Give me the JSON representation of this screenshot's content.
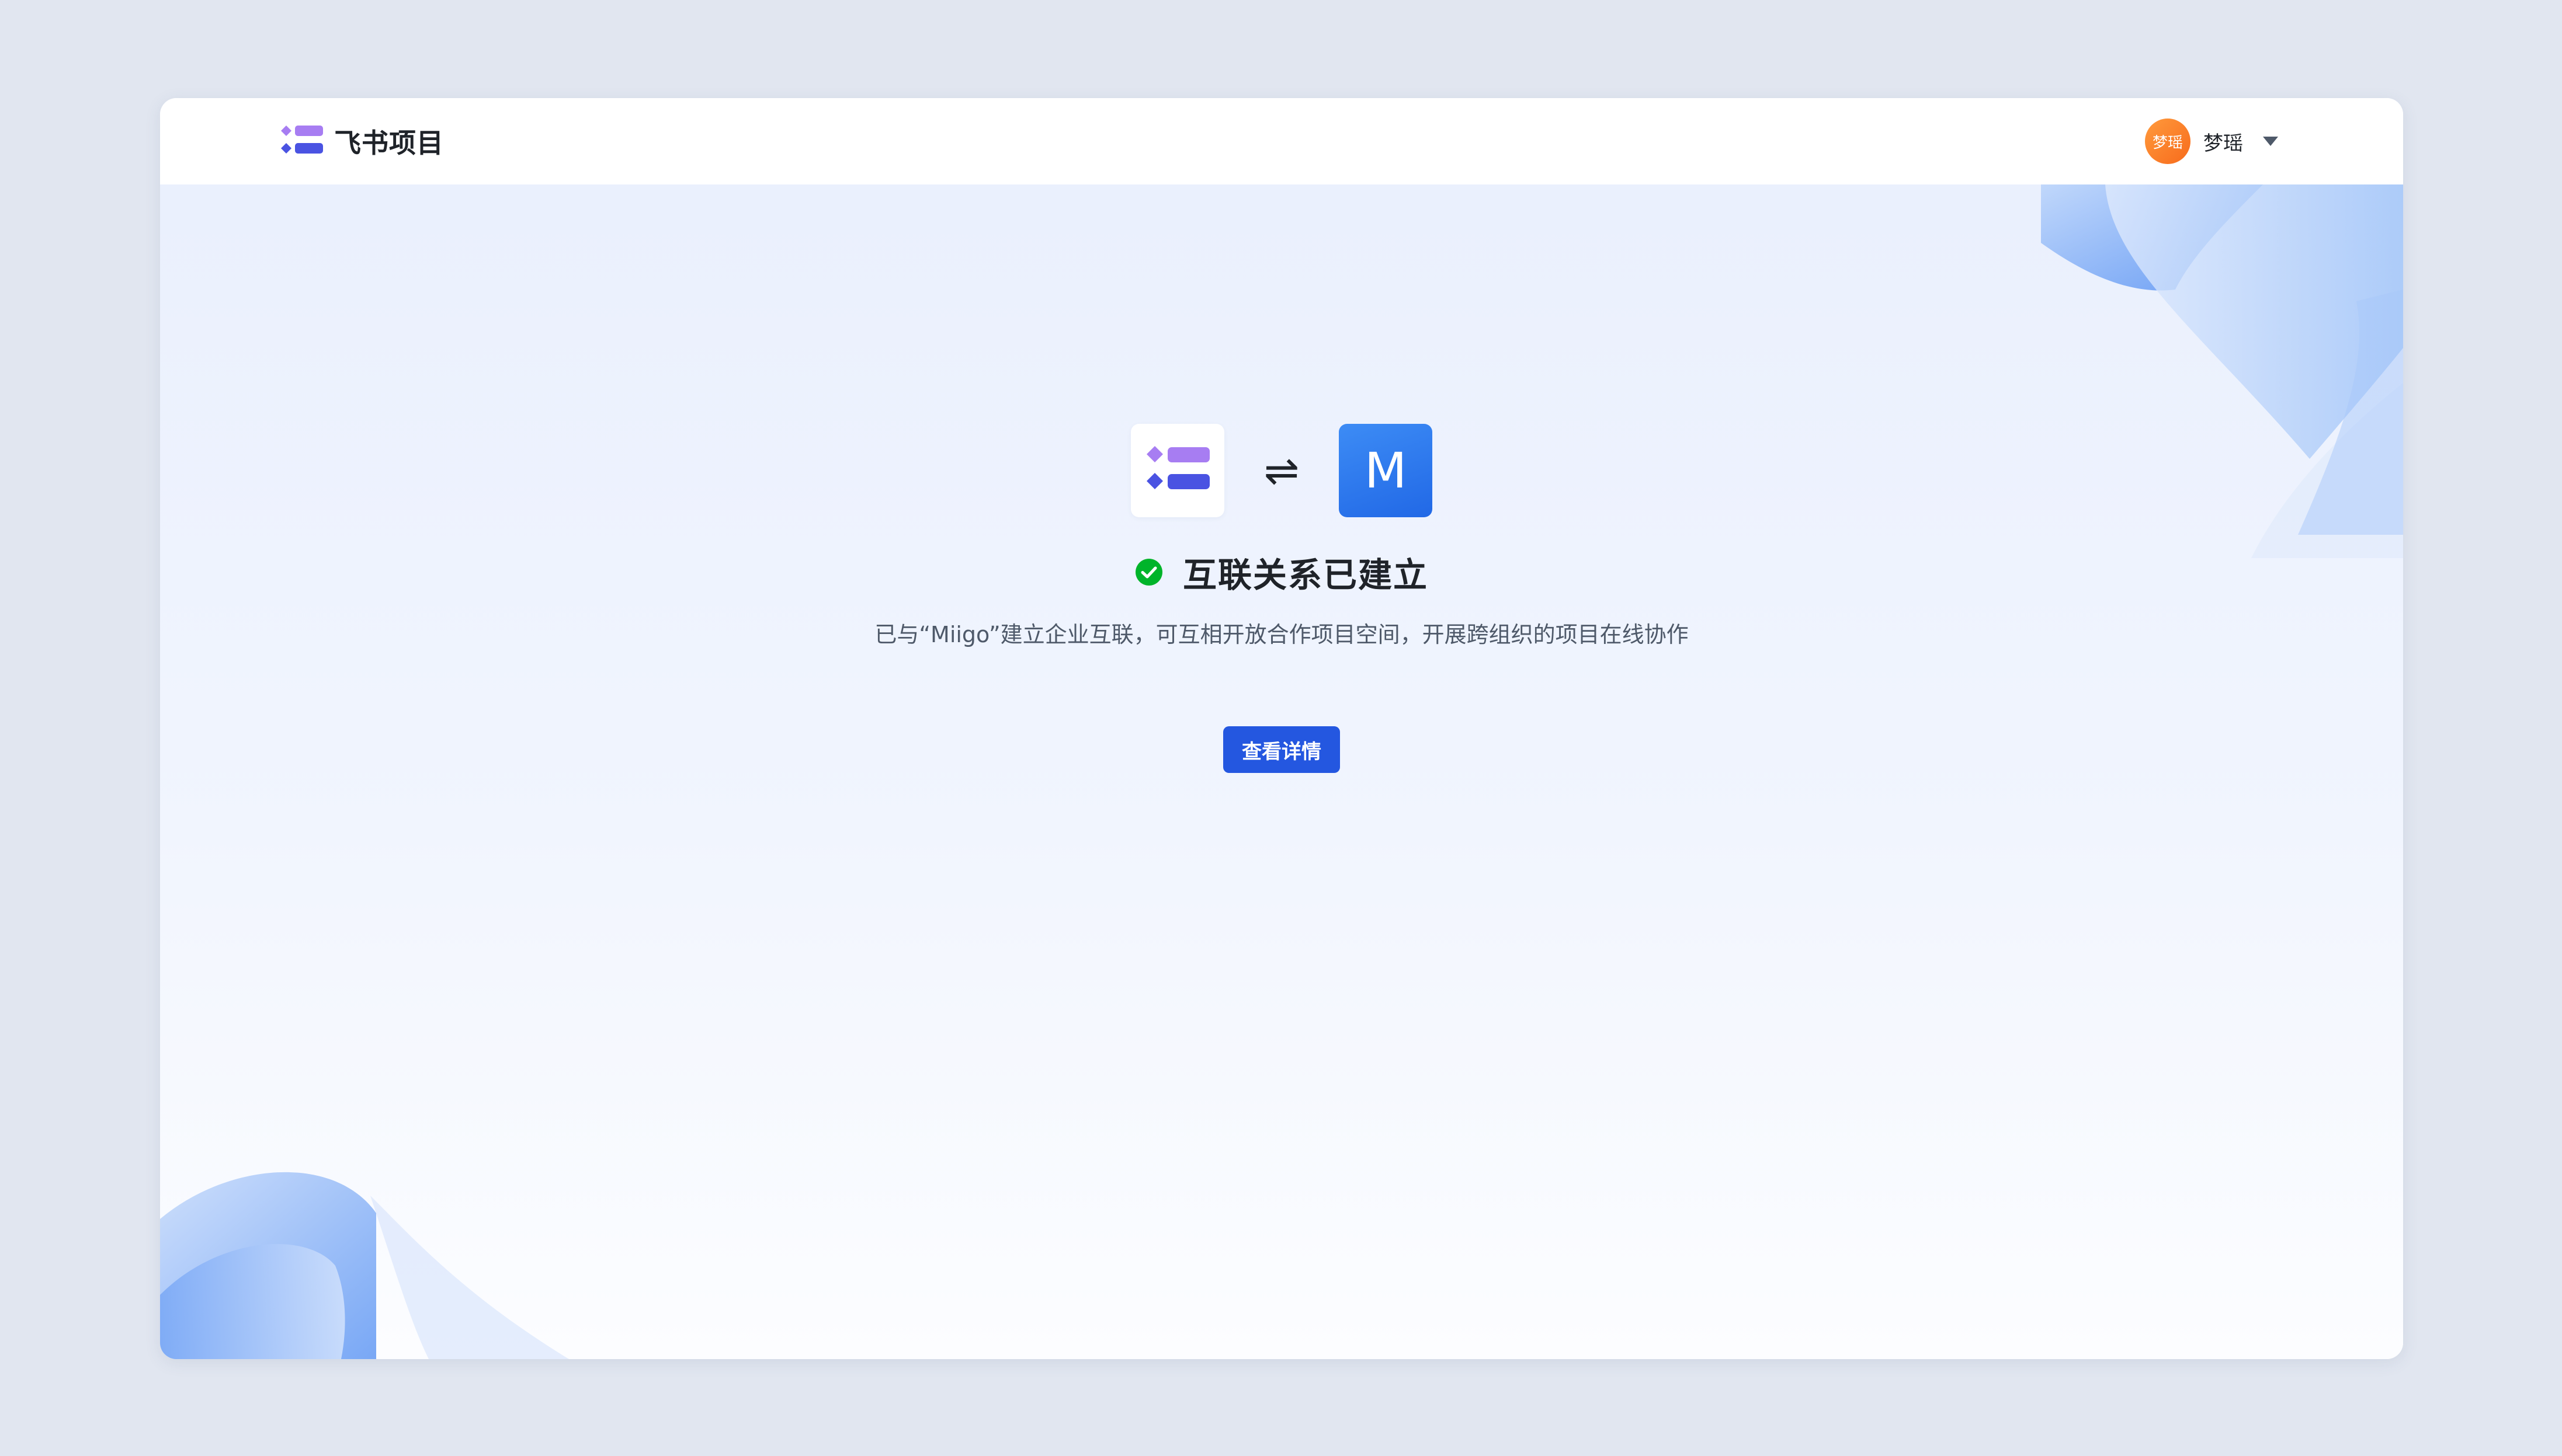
{
  "header": {
    "app_name": "飞书项目",
    "user": {
      "avatar_text": "梦瑶",
      "name": "梦瑶"
    }
  },
  "connection": {
    "swap_symbol": "⇌",
    "partner_logo_letter": "M",
    "title": "互联关系已建立",
    "description": "已与“Miigo”建立企业互联，可互相开放合作项目空间，开展跨组织的项目在线协作",
    "button_label": "查看详情"
  },
  "colors": {
    "primary": "#2457e0",
    "success": "#00b42a",
    "avatar": "#f7861c",
    "partner_logo": "#2c74ed"
  }
}
